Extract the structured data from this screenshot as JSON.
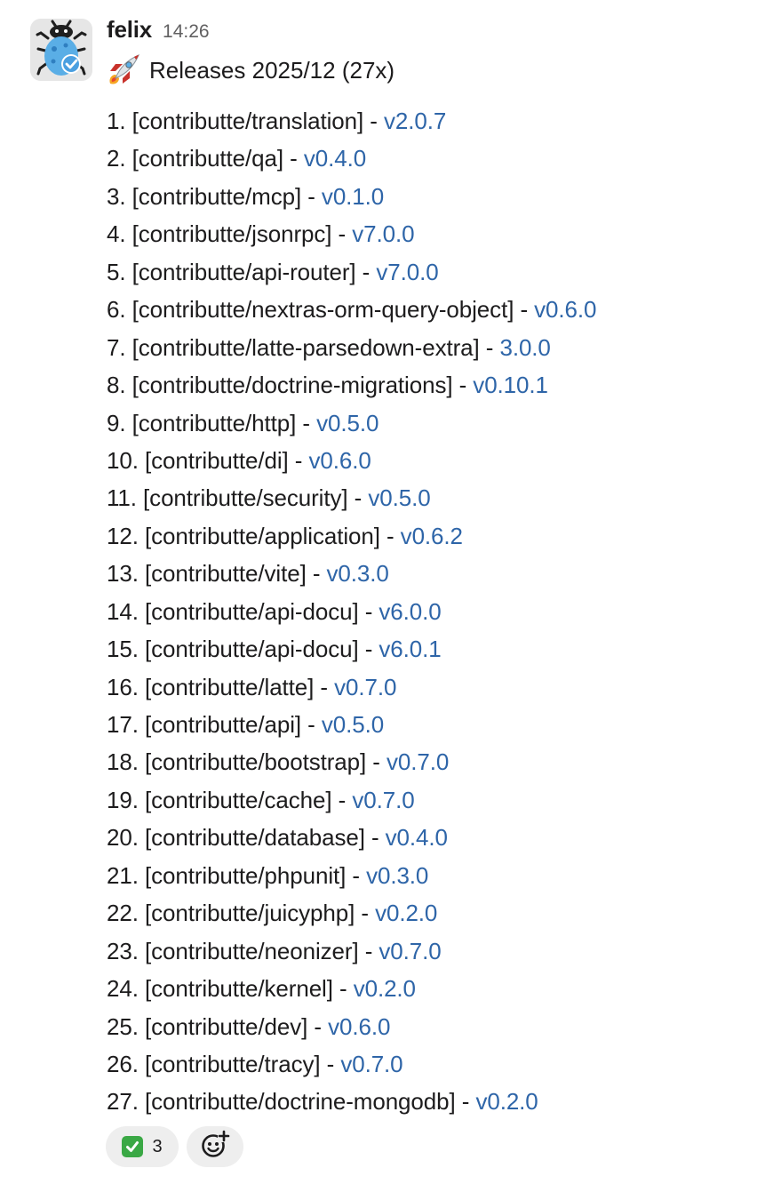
{
  "message": {
    "sender": "felix",
    "timestamp": "14:26",
    "title": "Releases 2025/12 (27x)",
    "title_icon": "rocket-emoji",
    "avatar_icon": "bug-with-check-avatar"
  },
  "releases": [
    {
      "number": "1.",
      "repo": "[contributte/translation]",
      "sep": " - ",
      "version": "v2.0.7"
    },
    {
      "number": "2.",
      "repo": "[contributte/qa]",
      "sep": " - ",
      "version": "v0.4.0"
    },
    {
      "number": "3.",
      "repo": "[contributte/mcp]",
      "sep": " - ",
      "version": "v0.1.0"
    },
    {
      "number": "4.",
      "repo": "[contributte/jsonrpc]",
      "sep": " - ",
      "version": "v7.0.0"
    },
    {
      "number": "5.",
      "repo": "[contributte/api-router]",
      "sep": " - ",
      "version": "v7.0.0"
    },
    {
      "number": "6.",
      "repo": "[contributte/nextras-orm-query-object]",
      "sep": " - ",
      "version": "v0.6.0"
    },
    {
      "number": "7.",
      "repo": "[contributte/latte-parsedown-extra]",
      "sep": " - ",
      "version": "3.0.0"
    },
    {
      "number": "8.",
      "repo": "[contributte/doctrine-migrations]",
      "sep": " - ",
      "version": "v0.10.1"
    },
    {
      "number": "9.",
      "repo": "[contributte/http]",
      "sep": " - ",
      "version": "v0.5.0"
    },
    {
      "number": "10.",
      "repo": "[contributte/di]",
      "sep": " - ",
      "version": "v0.6.0"
    },
    {
      "number": "11.",
      "repo": "[contributte/security]",
      "sep": " - ",
      "version": "v0.5.0"
    },
    {
      "number": "12.",
      "repo": "[contributte/application]",
      "sep": " - ",
      "version": "v0.6.2"
    },
    {
      "number": "13.",
      "repo": "[contributte/vite]",
      "sep": " - ",
      "version": "v0.3.0"
    },
    {
      "number": "14.",
      "repo": "[contributte/api-docu]",
      "sep": " - ",
      "version": "v6.0.0"
    },
    {
      "number": "15.",
      "repo": "[contributte/api-docu]",
      "sep": " - ",
      "version": "v6.0.1"
    },
    {
      "number": "16.",
      "repo": "[contributte/latte]",
      "sep": " - ",
      "version": "v0.7.0"
    },
    {
      "number": "17.",
      "repo": "[contributte/api]",
      "sep": " - ",
      "version": "v0.5.0"
    },
    {
      "number": "18.",
      "repo": "[contributte/bootstrap]",
      "sep": " - ",
      "version": "v0.7.0"
    },
    {
      "number": "19.",
      "repo": "[contributte/cache]",
      "sep": " - ",
      "version": "v0.7.0"
    },
    {
      "number": "20.",
      "repo": "[contributte/database]",
      "sep": " - ",
      "version": "v0.4.0"
    },
    {
      "number": "21.",
      "repo": "[contributte/phpunit]",
      "sep": " - ",
      "version": "v0.3.0"
    },
    {
      "number": "22.",
      "repo": "[contributte/juicyphp]",
      "sep": " - ",
      "version": "v0.2.0"
    },
    {
      "number": "23.",
      "repo": "[contributte/neonizer]",
      "sep": " - ",
      "version": "v0.7.0"
    },
    {
      "number": "24.",
      "repo": "[contributte/kernel]",
      "sep": " - ",
      "version": "v0.2.0"
    },
    {
      "number": "25.",
      "repo": "[contributte/dev]",
      "sep": " - ",
      "version": "v0.6.0"
    },
    {
      "number": "26.",
      "repo": "[contributte/tracy]",
      "sep": " - ",
      "version": "v0.7.0"
    },
    {
      "number": "27.",
      "repo": "[contributte/doctrine-mongodb]",
      "sep": " - ",
      "version": "v0.2.0"
    }
  ],
  "reactions": {
    "check": {
      "icon": "white-check-mark-emoji",
      "count": "3",
      "color": "#3aa845"
    },
    "add": {
      "icon": "add-reaction-icon"
    }
  },
  "colors": {
    "link": "#2e65a8",
    "text": "#1d1c1d",
    "muted": "#616061",
    "pill": "#eeeeee"
  }
}
